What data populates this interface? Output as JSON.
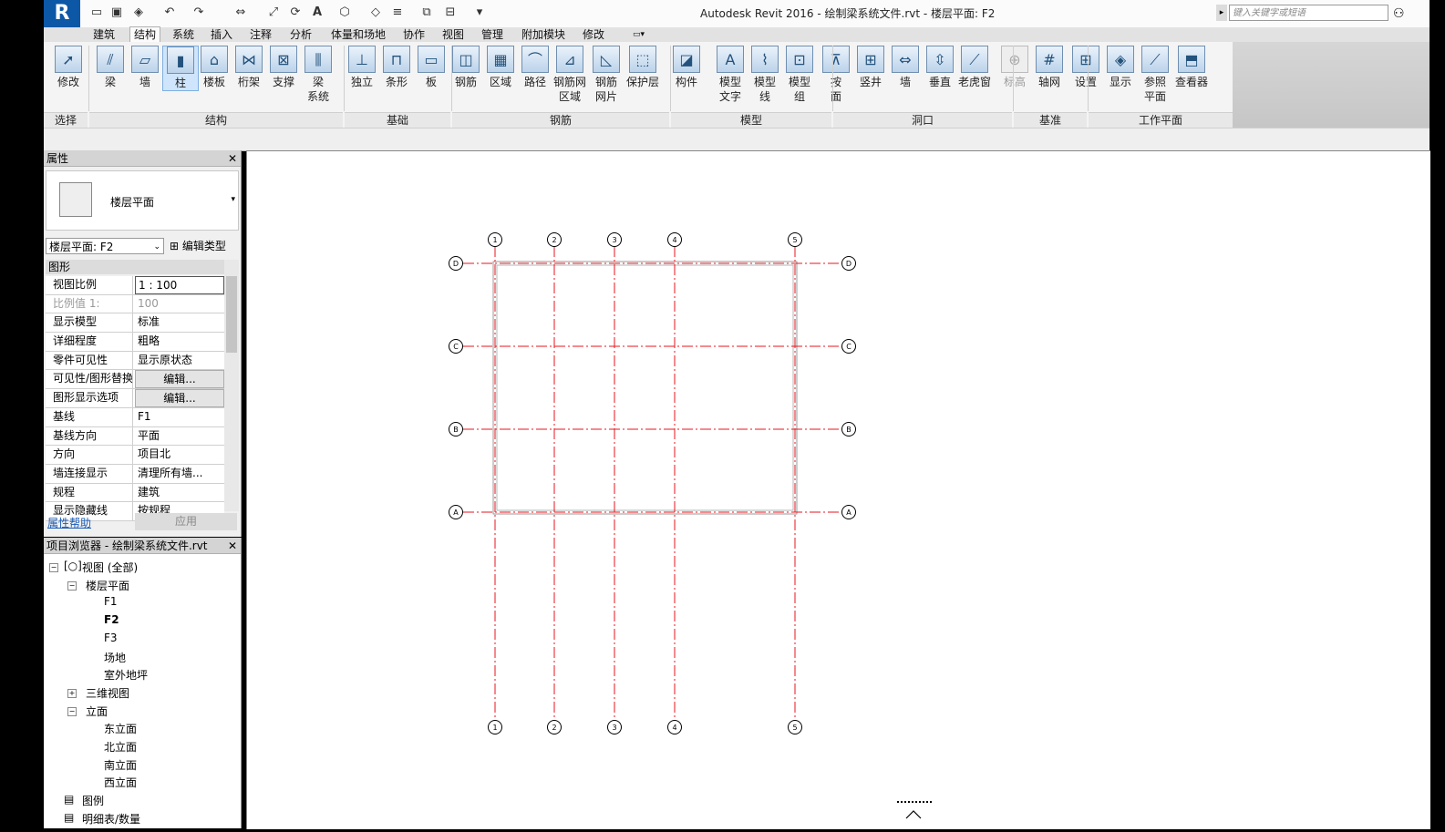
{
  "title": {
    "app_badge": "R",
    "text": "Autodesk Revit 2016 -    绘制梁系统文件.rvt - 楼层平面: F2",
    "search_placeholder": "键入关键字或短语"
  },
  "tabs": [
    "建筑",
    "结构",
    "系统",
    "插入",
    "注释",
    "分析",
    "体量和场地",
    "协作",
    "视图",
    "管理",
    "附加模块",
    "修改"
  ],
  "active_tab": "结构",
  "ribbon": {
    "buttons": [
      {
        "label": "修改",
        "icon": "cursor-icon"
      },
      {
        "label": "梁",
        "icon": "beam-icon"
      },
      {
        "label": "墙",
        "icon": "wall-icon"
      },
      {
        "label": "柱",
        "icon": "column-icon"
      },
      {
        "label": "楼板",
        "icon": "floor-icon"
      },
      {
        "label": "桁架",
        "icon": "truss-icon"
      },
      {
        "label": "支撑",
        "icon": "brace-icon"
      },
      {
        "label": "梁\n系统",
        "icon": "beam-system-icon"
      },
      {
        "label": "独立",
        "icon": "isolated-footing-icon"
      },
      {
        "label": "条形",
        "icon": "wall-footing-icon"
      },
      {
        "label": "板",
        "icon": "slab-icon"
      },
      {
        "label": "钢筋",
        "icon": "rebar-icon"
      },
      {
        "label": "区域",
        "icon": "area-icon"
      },
      {
        "label": "路径",
        "icon": "path-icon"
      },
      {
        "label": "钢筋网\n区域",
        "icon": "fabric-area-icon"
      },
      {
        "label": "钢筋\n网片",
        "icon": "fabric-sheet-icon"
      },
      {
        "label": "保护层",
        "icon": "cover-icon"
      },
      {
        "label": "构件",
        "icon": "component-icon"
      },
      {
        "label": "模型\n文字",
        "icon": "model-text-icon"
      },
      {
        "label": "模型\n线",
        "icon": "model-line-icon"
      },
      {
        "label": "模型\n组",
        "icon": "model-group-icon"
      },
      {
        "label": "按\n面",
        "icon": "by-face-icon"
      },
      {
        "label": "竖井",
        "icon": "shaft-icon"
      },
      {
        "label": "墙",
        "icon": "wall-opening-icon"
      },
      {
        "label": "垂直",
        "icon": "vertical-icon"
      },
      {
        "label": "老虎窗",
        "icon": "dormer-icon"
      },
      {
        "label": "标高",
        "icon": "level-icon"
      },
      {
        "label": "轴网",
        "icon": "grid-icon"
      },
      {
        "label": "设置",
        "icon": "set-icon"
      },
      {
        "label": "显示",
        "icon": "show-icon"
      },
      {
        "label": "参照\n平面",
        "icon": "ref-plane-icon"
      },
      {
        "label": "查看器",
        "icon": "viewer-icon"
      }
    ],
    "panels": [
      "选择",
      "结构",
      "基础",
      "钢筋",
      "模型",
      "洞口",
      "基准",
      "工作平面"
    ]
  },
  "properties": {
    "title": "属性",
    "type_label": "楼层平面",
    "view_selector": "楼层平面: F2",
    "edit_type": "编辑类型",
    "category": "图形",
    "rows": [
      {
        "key": "视图比例",
        "value": "1 : 100"
      },
      {
        "key": "比例值 1:",
        "value": "100"
      },
      {
        "key": "显示模型",
        "value": "标准"
      },
      {
        "key": "详细程度",
        "value": "粗略"
      },
      {
        "key": "零件可见性",
        "value": "显示原状态"
      },
      {
        "key": "可见性/图形替换",
        "value": "编辑..."
      },
      {
        "key": "图形显示选项",
        "value": "编辑..."
      },
      {
        "key": "基线",
        "value": "F1"
      },
      {
        "key": "基线方向",
        "value": "平面"
      },
      {
        "key": "方向",
        "value": "项目北"
      },
      {
        "key": "墙连接显示",
        "value": "清理所有墙..."
      },
      {
        "key": "规程",
        "value": "建筑"
      },
      {
        "key": "显示隐藏线",
        "value": "按规程"
      }
    ],
    "help_link": "属性帮助",
    "apply": "应用"
  },
  "browser": {
    "title": "项目浏览器 - 绘制梁系统文件.rvt",
    "items": [
      {
        "label": "视图 (全部)",
        "level": 0
      },
      {
        "label": "楼层平面",
        "level": 1
      },
      {
        "label": "F1",
        "level": 2
      },
      {
        "label": "F2",
        "level": 2
      },
      {
        "label": "F3",
        "level": 2
      },
      {
        "label": "场地",
        "level": 2
      },
      {
        "label": "室外地坪",
        "level": 2
      },
      {
        "label": "三维视图",
        "level": 1
      },
      {
        "label": "立面",
        "level": 1
      },
      {
        "label": "东立面",
        "level": 2
      },
      {
        "label": "北立面",
        "level": 2
      },
      {
        "label": "南立面",
        "level": 2
      },
      {
        "label": "西立面",
        "level": 2
      },
      {
        "label": "图例",
        "level": 0
      },
      {
        "label": "明细表/数量",
        "level": 0
      }
    ]
  },
  "canvas": {
    "vertical_grids": [
      "1",
      "2",
      "3",
      "4",
      "5"
    ],
    "horizontal_grids": [
      "D",
      "C",
      "B",
      "A"
    ],
    "grid_color": "#e8141c"
  }
}
